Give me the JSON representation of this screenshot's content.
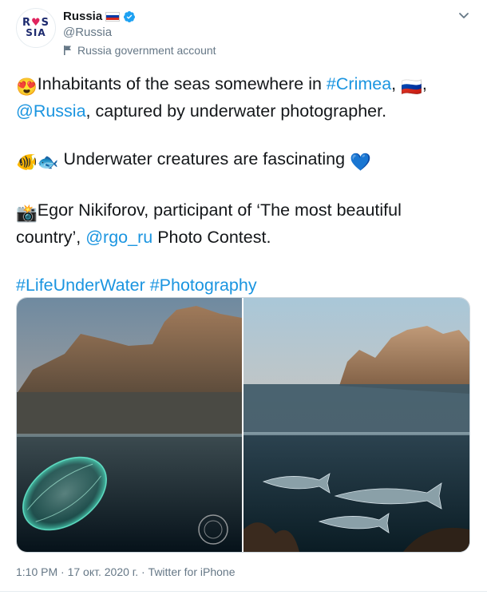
{
  "author": {
    "name": "Russia",
    "handle": "@Russia",
    "label": "Russia government account",
    "avatar_text": [
      "R",
      "S",
      "SIA"
    ]
  },
  "tweet": {
    "line1_emoji": "😍",
    "line1_text": "Inhabitants of the seas somewhere in ",
    "hashtag_crimea": "#Crimea",
    "line1_comma": ", ",
    "line1_flag": "🇷🇺",
    "line1b_sep": ",",
    "mention_russia": "@Russia",
    "line2_text": ", captured by underwater photographer.",
    "line3_emoji1": "🐠",
    "line3_emoji2": "🐟",
    "line3_text": " Underwater creatures are fascinating ",
    "line3_heart": "💙",
    "line4_emoji": "📸",
    "line4_text": "Egor Nikiforov, participant of ‘The most beautiful country’, ",
    "mention_rgo": "@rgo_ru",
    "line4_end": " Photo Contest.",
    "hashtag_life": "#LifeUnderWater",
    "hashtag_photo": "#Photography"
  },
  "meta": {
    "time": "1:10 PM",
    "sep1": " · ",
    "date": "17 окт. 2020 г.",
    "sep2": " · ",
    "source": "Twitter for iPhone"
  },
  "colors": {
    "link": "#1b95e0",
    "secondary": "#657786",
    "verified": "#1da1f2"
  },
  "icons": {
    "verified": "verified-badge-icon",
    "flag": "flag-icon",
    "chevron": "chevron-down-icon"
  }
}
